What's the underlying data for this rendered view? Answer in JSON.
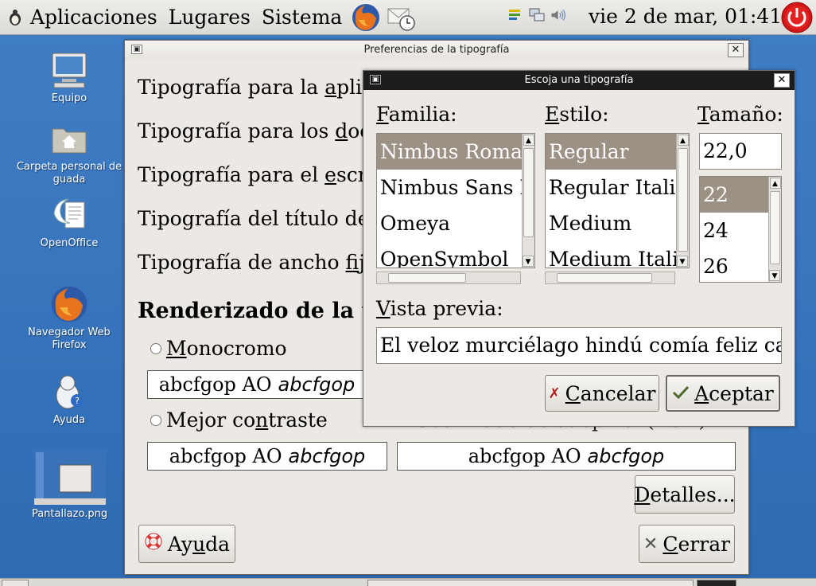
{
  "top_panel": {
    "menus": [
      "Aplicaciones",
      "Lugares",
      "Sistema"
    ],
    "clock": "vie  2 de mar, 01:41"
  },
  "desktop": {
    "icons": [
      {
        "label": "Equipo",
        "icon": "computer-icon"
      },
      {
        "label": "Carpeta personal de guada",
        "icon": "home-folder-icon"
      },
      {
        "label": "OpenOffice",
        "icon": "openoffice-icon"
      },
      {
        "label": "Navegador Web Firefox",
        "icon": "firefox-icon"
      },
      {
        "label": "Ayuda",
        "icon": "help-icon"
      },
      {
        "label": "Pantallazo.png",
        "icon": "image-file-icon"
      }
    ]
  },
  "pref_window": {
    "title": "Preferencias de la tipografía",
    "labels": [
      {
        "pre": "Tipografía para la ",
        "key": "a",
        "post": "plica"
      },
      {
        "pre": "Tipografía para los ",
        "key": "d",
        "post": "ocu"
      },
      {
        "pre": "Tipografía para el ",
        "key": "e",
        "post": "scrit"
      },
      {
        "pre": "Tipografía del título de l",
        "key": "",
        "post": ""
      },
      {
        "pre": "Tipografía de ancho ",
        "key": "f",
        "post": "ijo"
      }
    ],
    "rendering_heading": "Renderizado de la tipog",
    "options": [
      {
        "pre": "",
        "key": "M",
        "post": "onocromo"
      },
      {
        "pre": "Mejor co",
        "key": "n",
        "post": "traste"
      }
    ],
    "partial_option": "Suavizado de subpíxel (LCD)",
    "sample_text": "abcfgop AO",
    "sample_italic": "abcfgop",
    "details_button": {
      "key": "D",
      "post": "etalles..."
    },
    "help_button": {
      "pre": "Ay",
      "key": "u",
      "post": "da"
    },
    "close_button": {
      "key": "C",
      "post": "errar"
    }
  },
  "font_dialog": {
    "title": "Escoja una tipografía",
    "family_label": {
      "key": "F",
      "post": "amilia:"
    },
    "style_label": {
      "key": "E",
      "post": "stilo:"
    },
    "size_label": {
      "key": "T",
      "post": "amaño:"
    },
    "families": [
      "Nimbus Roman",
      "Nimbus Sans L",
      "Omeya",
      "OpenSymbol"
    ],
    "styles": [
      "Regular",
      "Regular Italic",
      "Medium",
      "Medium Italic"
    ],
    "size_value": "22,0",
    "sizes": [
      "22",
      "24",
      "26"
    ],
    "preview_label": {
      "key": "V",
      "post": "ista previa:"
    },
    "preview_text": "El veloz murciélago hindú comía feliz cardillo y kiwi",
    "cancel_button": {
      "key": "C",
      "post": "ancelar"
    },
    "ok_button": {
      "key": "A",
      "post": "ceptar"
    }
  }
}
